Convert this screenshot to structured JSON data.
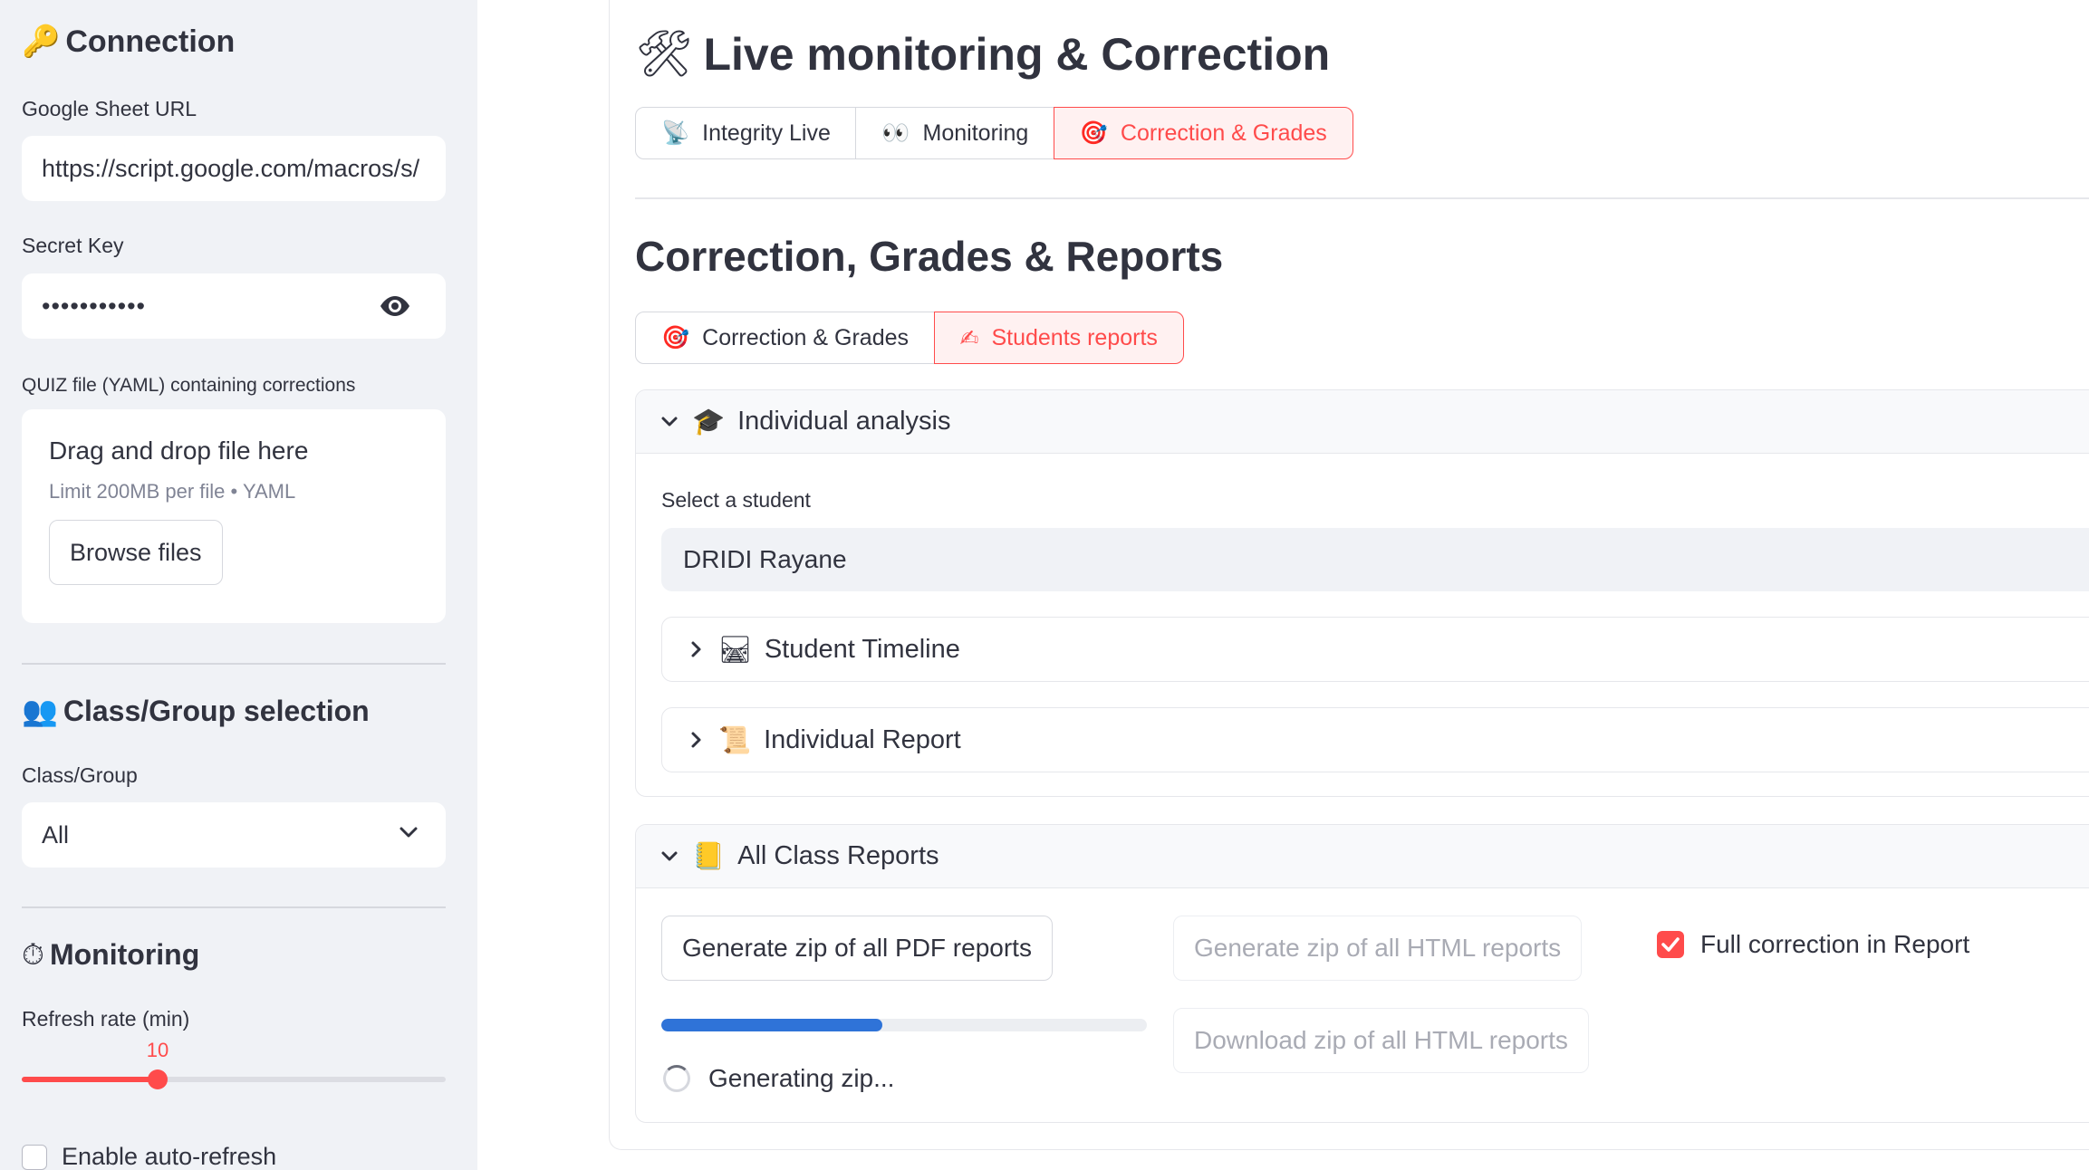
{
  "sidebar": {
    "connection": {
      "icon": "🔑",
      "heading": "Connection"
    },
    "sheet_url": {
      "label": "Google Sheet URL",
      "value": "https://script.google.com/macros/s/"
    },
    "secret_key": {
      "label": "Secret Key",
      "value": "•••••••••••"
    },
    "quiz_file": {
      "label": "QUIZ file (YAML) containing corrections",
      "drop_title": "Drag and drop file here",
      "limit": "Limit 200MB per file • YAML",
      "browse_label": "Browse files"
    },
    "class_group": {
      "icon": "👥",
      "heading": "Class/Group selection",
      "label": "Class/Group",
      "value": "All"
    },
    "monitoring": {
      "icon": "⏱",
      "heading": "Monitoring",
      "refresh_label": "Refresh rate (min)",
      "refresh_value": "10",
      "refresh_fraction": 0.32
    },
    "auto_refresh": {
      "label": "Enable auto-refresh",
      "checked": false
    }
  },
  "main": {
    "title_icon": "🛠",
    "title": "Live monitoring & Correction",
    "tabs": [
      {
        "icon": "📡",
        "label": "Integrity Live",
        "active": false
      },
      {
        "icon": "👀",
        "label": "Monitoring",
        "active": false
      },
      {
        "icon": "🎯",
        "label": "Correction & Grades",
        "active": true
      }
    ],
    "section_title": "Correction, Grades & Reports",
    "subtabs": [
      {
        "icon": "🎯",
        "label": "Correction & Grades",
        "active": false
      },
      {
        "icon": "✍",
        "label": "Students reports",
        "active": true
      }
    ],
    "individual": {
      "icon": "🎓",
      "heading": "Individual analysis",
      "select_label": "Select a student",
      "selected_student": "DRIDI Rayane",
      "timeline": {
        "icon": "🛤",
        "label": "Student Timeline"
      },
      "report": {
        "icon": "📜",
        "label": "Individual Report"
      }
    },
    "class_reports": {
      "icon": "📒",
      "heading": "All Class Reports",
      "pdf_button": "Generate zip of all PDF reports",
      "html_button": "Generate zip of all HTML reports",
      "download_button": "Download zip of all HTML reports",
      "full_correction_label": "Full correction in Report",
      "full_correction_checked": true,
      "progress_fraction": 0.455,
      "status_text": "Generating zip..."
    }
  },
  "colors": {
    "accent": "#ff4b4b",
    "progress": "#2f73d8",
    "sidebar_bg": "#f0f2f6"
  }
}
